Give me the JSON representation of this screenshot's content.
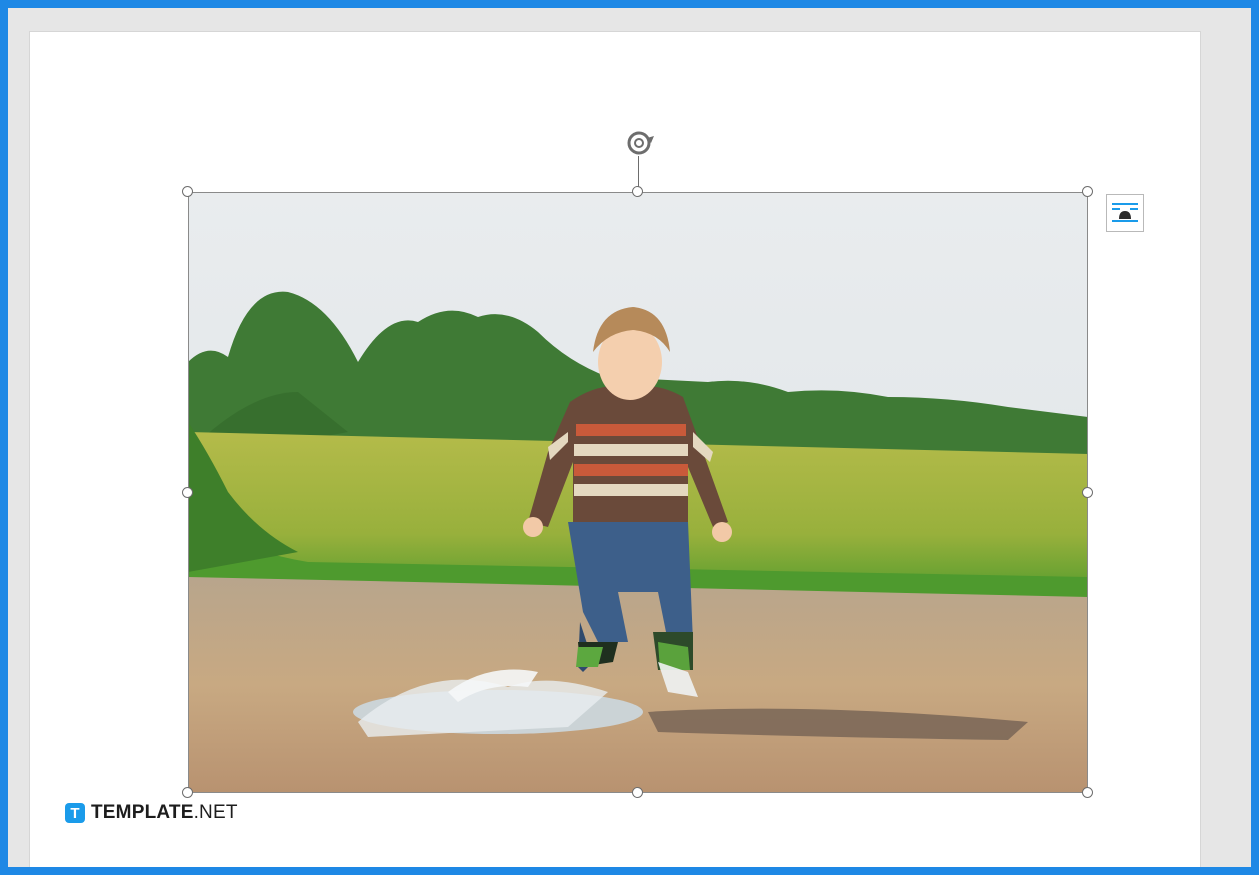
{
  "brand": {
    "logo_letter": "T",
    "name_bold": "TEMPLATE",
    "name_rest": ".NET",
    "accent": "#1a9bea"
  },
  "image": {
    "subject": "photo",
    "selected": true,
    "icons": {
      "rotate": "rotate-icon",
      "layout_options": "layout-options-icon"
    }
  },
  "colors": {
    "frame": "#1e88e5",
    "workspace": "#e6e6e6",
    "page": "#ffffff"
  }
}
